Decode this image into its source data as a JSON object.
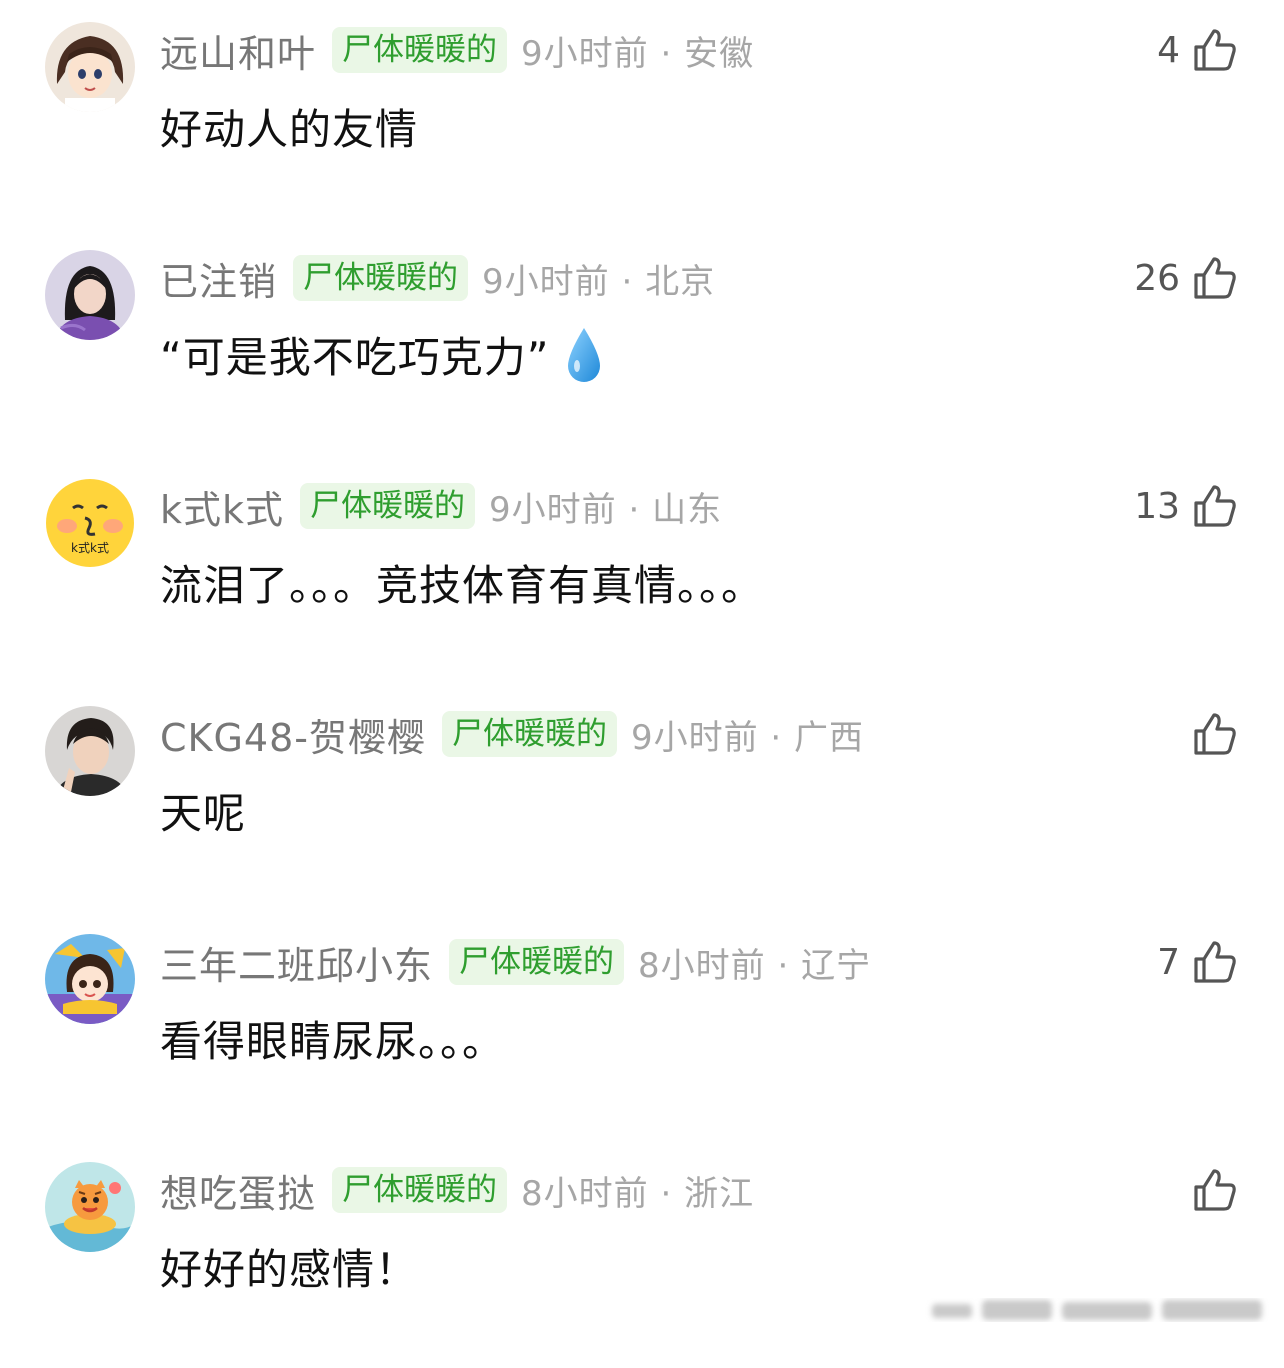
{
  "comments": [
    {
      "username": "远山和叶",
      "badge": "尸体暖暖的",
      "meta": "9小时前 · 安徽",
      "content": "好动人的友情",
      "likes": "4",
      "avatar": "anime-girl-avatar"
    },
    {
      "username": "已注销",
      "badge": "尸体暖暖的",
      "meta": "9小时前 · 北京",
      "content": "“可是我不吃巧克力”",
      "emoji": "water-drop-icon",
      "likes": "26",
      "avatar": "woman-photo-avatar"
    },
    {
      "username": "k式k式",
      "badge": "尸体暖暖的",
      "meta": "9小时前 · 山东",
      "content": "流泪了。。。竞技体育有真情。。。",
      "likes": "13",
      "avatar": "smiley-face-avatar",
      "avatar_text": "k式k式"
    },
    {
      "username": "CKG48-贺樱樱",
      "badge": "尸体暖暖的",
      "meta": "9小时前 · 广西",
      "content": "天呢",
      "likes": "",
      "avatar": "man-photo-avatar"
    },
    {
      "username": "三年二班邱小东",
      "badge": "尸体暖暖的",
      "meta": "8小时前 · 辽宁",
      "content": "看得眼睛尿尿。。。",
      "likes": "7",
      "avatar": "cartoon-girl-avatar"
    },
    {
      "username": "想吃蛋挞",
      "badge": "尸体暖暖的",
      "meta": "8小时前 · 浙江",
      "content": "好好的感情！",
      "likes": "",
      "avatar": "cartoon-tiger-avatar"
    }
  ],
  "colors": {
    "badge_bg": "#eaf7e6",
    "badge_text": "#2f9e2f",
    "username": "#777777",
    "meta": "#a6a6a6"
  }
}
